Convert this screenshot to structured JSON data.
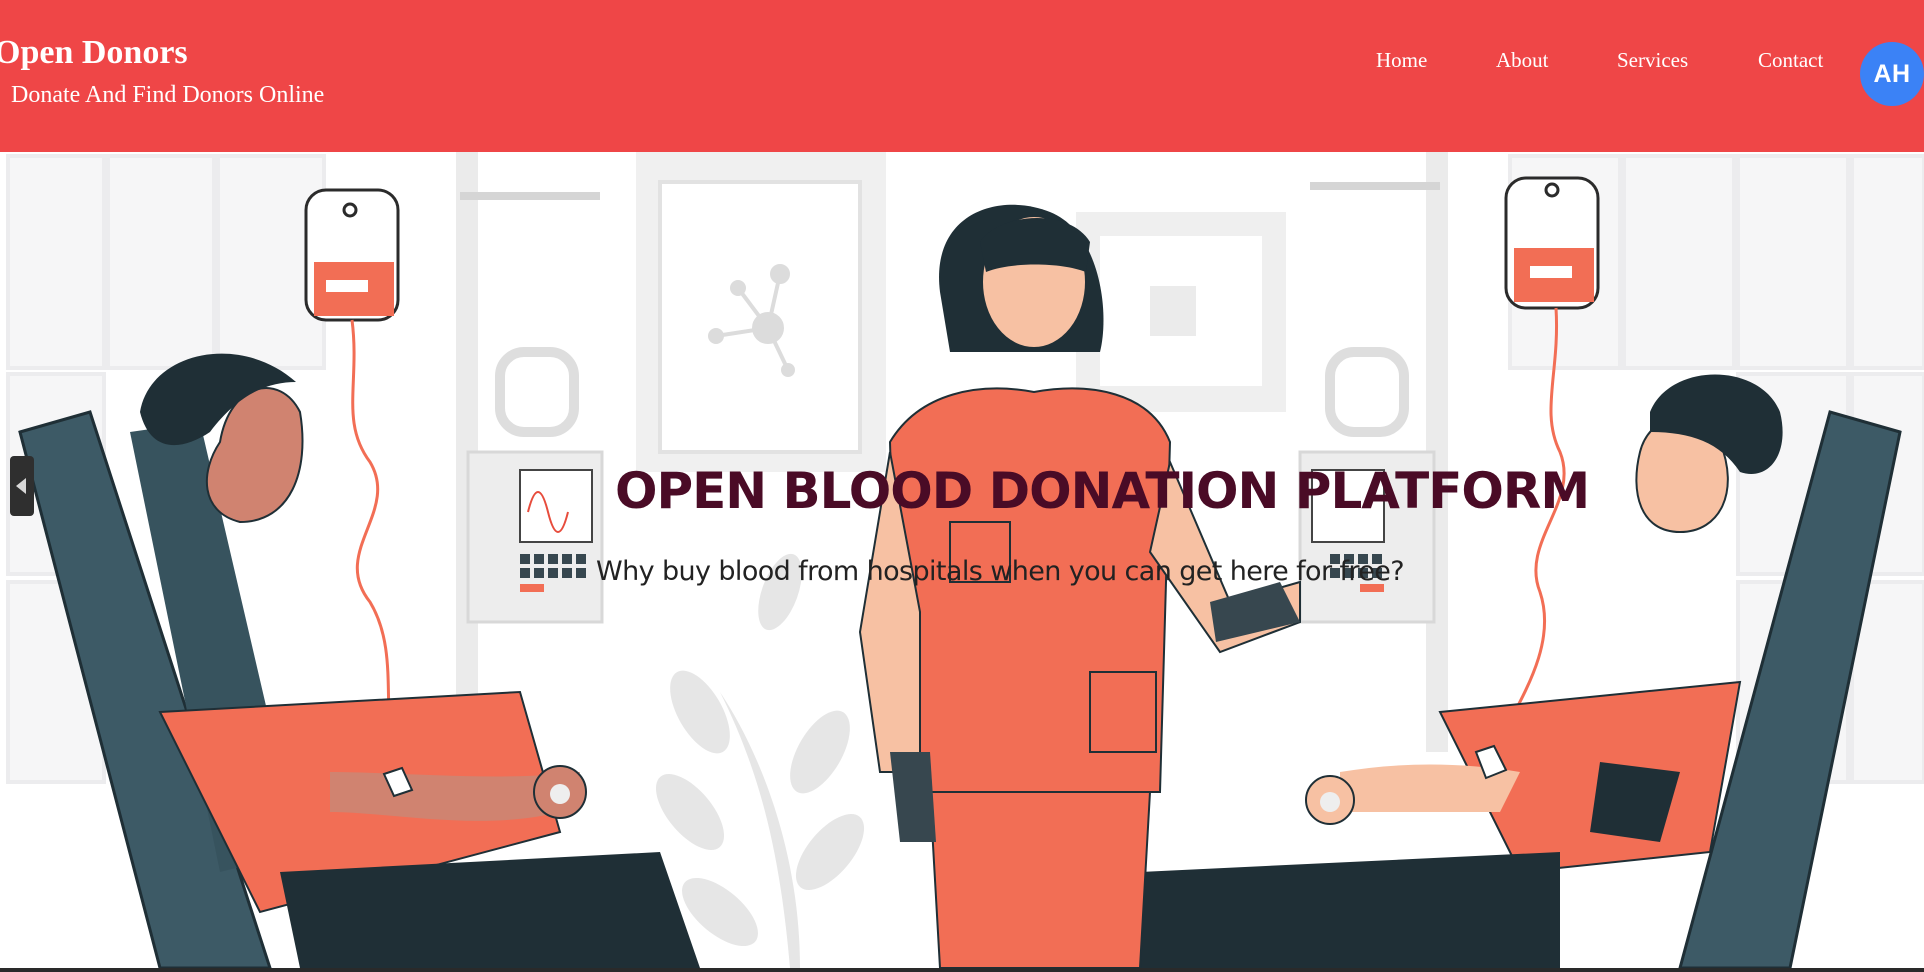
{
  "header": {
    "brand_title": "Open Donors",
    "tagline": "Donate And Find Donors Online",
    "background_color": "#ef4647"
  },
  "nav": {
    "items": [
      {
        "label": "Home"
      },
      {
        "label": "About"
      },
      {
        "label": "Services"
      },
      {
        "label": "Contact"
      }
    ]
  },
  "user": {
    "initials": "AH",
    "avatar_color": "#3b82f6"
  },
  "hero": {
    "title": "OPEN BLOOD DONATION PLATFORM",
    "subtitle": "Why buy blood from hospitals when you can get here for free?",
    "title_color": "#4a0b26",
    "accent_color": "#f26e55",
    "illustration_icon": "blood-donation-illustration"
  },
  "carousel": {
    "prev_icon": "chevron-left-icon"
  }
}
